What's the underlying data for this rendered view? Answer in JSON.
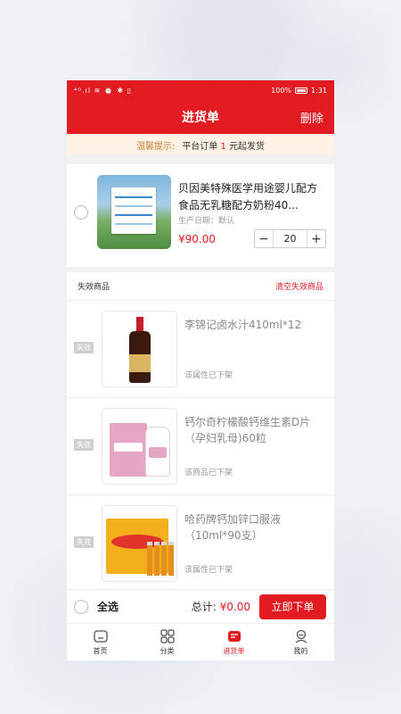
{
  "status_bar": {
    "left_icons": "⁴ᴳ.ıl ≋ ⏰ ✱ ▯",
    "battery_text": "100%",
    "time": "1:31"
  },
  "header": {
    "title": "进货单",
    "action_label": "删除"
  },
  "tip": {
    "label": "温馨提示:",
    "text_before": "平台订单",
    "amount": "1",
    "text_after": "元起发货"
  },
  "cart_item": {
    "title": "贝因美特殊医学用途婴儿配方食品无乳糖配方奶粉40...",
    "production_date": "生产日期：默认",
    "price": "¥90.00",
    "quantity": "20",
    "minus": "−",
    "plus": "+"
  },
  "invalid_section": {
    "title": "失效商品",
    "clear_label": "清空失效商品",
    "badge": "失效",
    "items": [
      {
        "title": "李锦记卤水汁410ml*12",
        "note": "该属性已下架"
      },
      {
        "title": "钙尔奇柠檬酸钙维生素D片（孕妇乳母)60粒",
        "note": "该商品已下架"
      },
      {
        "title": "哈药牌钙加锌口服液（10ml*90支）",
        "note": "该属性已下架"
      }
    ]
  },
  "checkout": {
    "select_all": "全选",
    "total_label": "总计: ",
    "total_value": "¥0.00",
    "order_button": "立即下单"
  },
  "tabbar": {
    "items": [
      {
        "label": "首页",
        "icon": "home-icon"
      },
      {
        "label": "分类",
        "icon": "grid-icon"
      },
      {
        "label": "进货单",
        "icon": "cart-list-icon"
      },
      {
        "label": "我的",
        "icon": "profile-icon"
      }
    ],
    "active_index": 2
  },
  "colors": {
    "brand_red": "#e21b23",
    "tip_bg": "#fdf2e4",
    "tip_label": "#c8853a"
  }
}
